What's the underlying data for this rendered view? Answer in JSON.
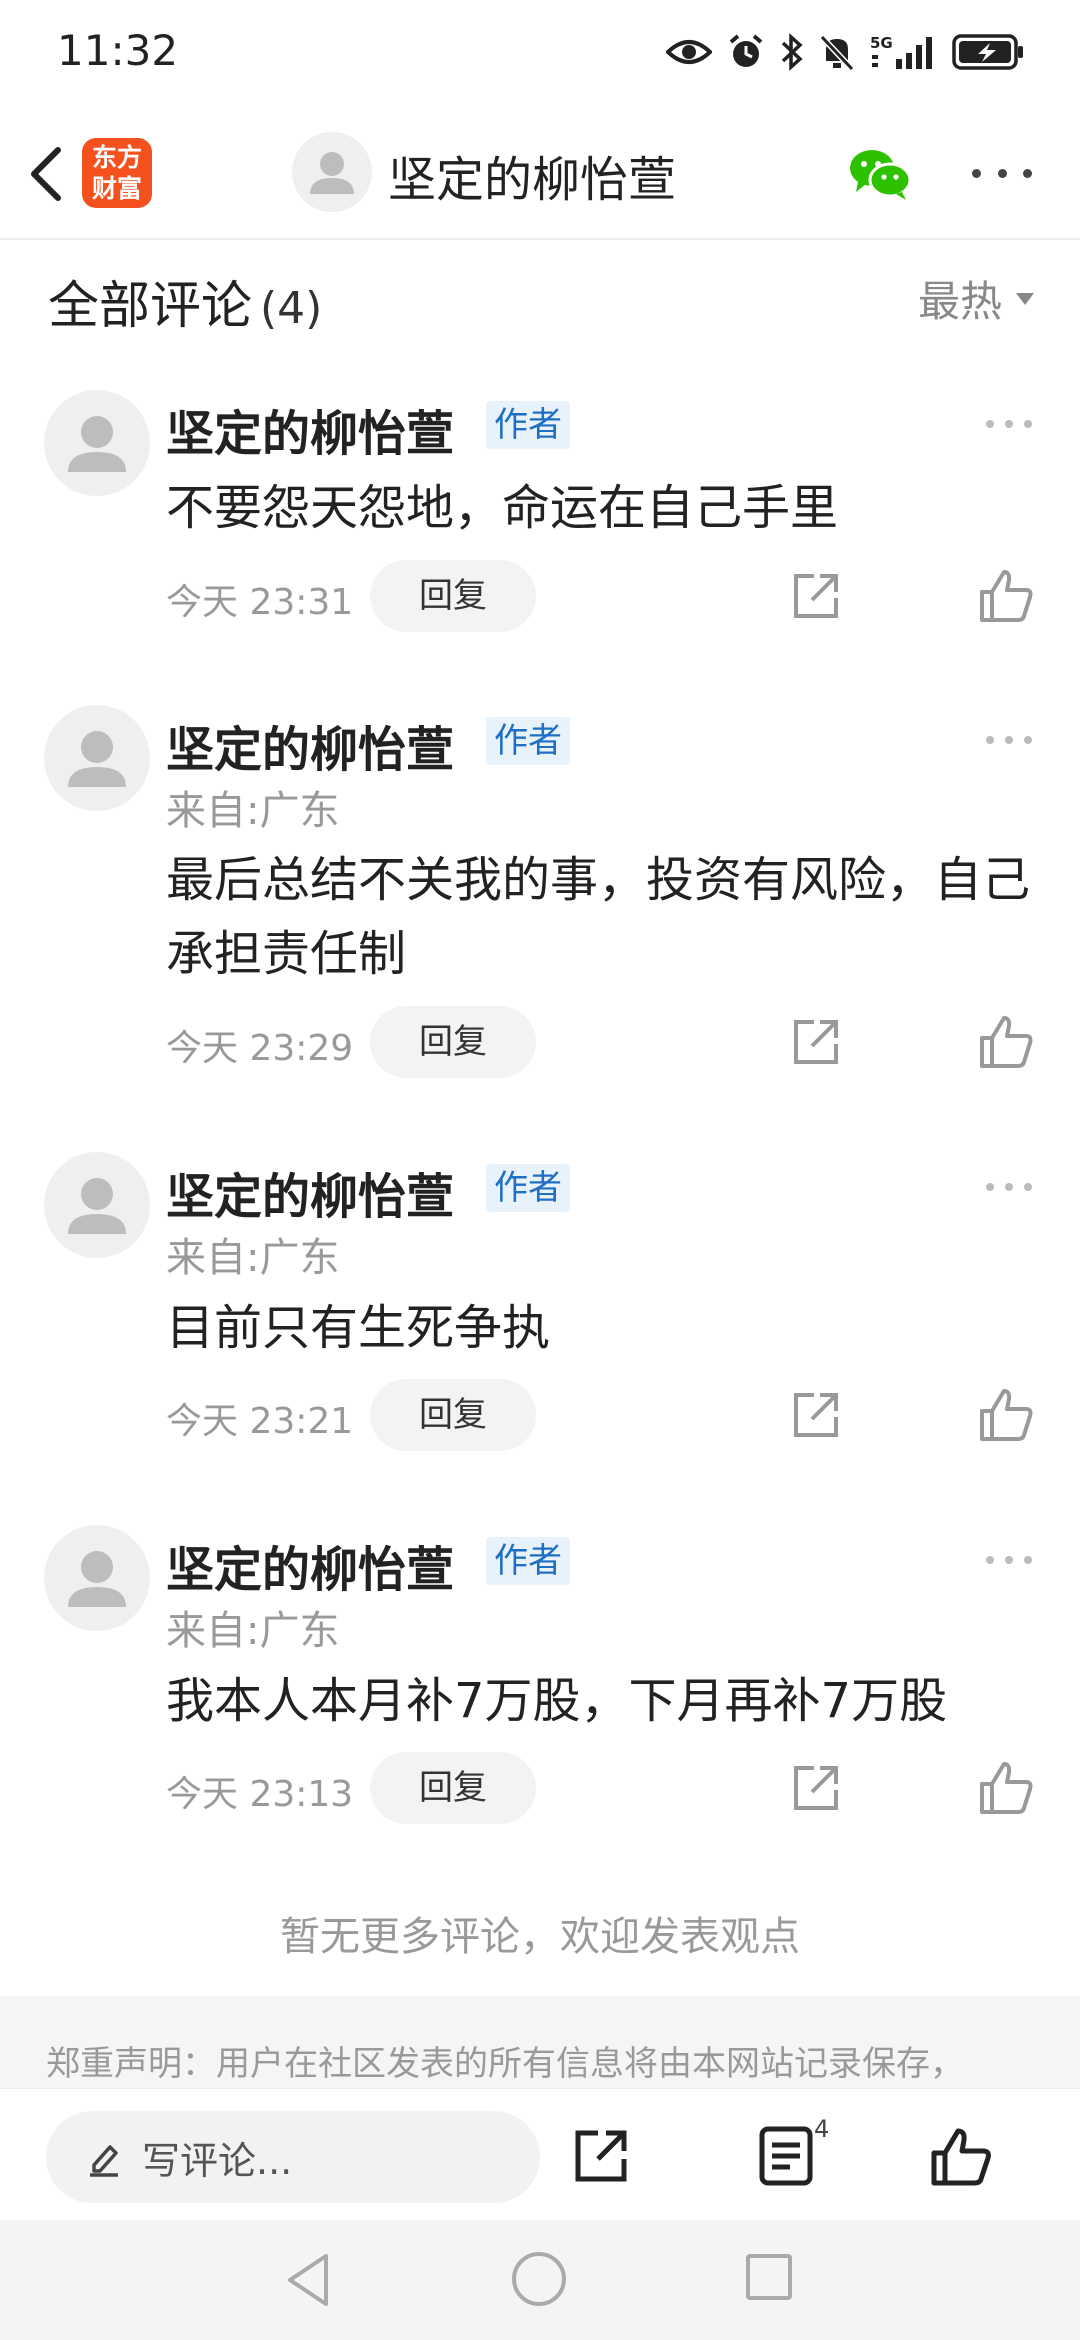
{
  "status_bar": {
    "time": "11:32",
    "icons": [
      "eye-icon",
      "alarm-icon",
      "bluetooth-icon",
      "mute-icon",
      "5g-signal-icon",
      "battery-charging-icon"
    ],
    "network_label": "5G"
  },
  "header": {
    "app_logo_line1": "东方",
    "app_logo_line2": "财富",
    "title": "坚定的柳怡萱"
  },
  "section": {
    "title": "全部评论",
    "count": "(4)",
    "sort_label": "最热"
  },
  "comments": [
    {
      "name": "坚定的柳怡萱",
      "tag": "作者",
      "location": "",
      "text": "不要怨天怨地，命运在自己手里",
      "time": "今天 23:31",
      "reply_label": "回复"
    },
    {
      "name": "坚定的柳怡萱",
      "tag": "作者",
      "location": "来自:广东",
      "text": "最后总结不关我的事，投资有风险，自己承担责任制",
      "time": "今天 23:29",
      "reply_label": "回复"
    },
    {
      "name": "坚定的柳怡萱",
      "tag": "作者",
      "location": "来自:广东",
      "text": "目前只有生死争执",
      "time": "今天 23:21",
      "reply_label": "回复"
    },
    {
      "name": "坚定的柳怡萱",
      "tag": "作者",
      "location": "来自:广东",
      "text": "我本人本月补7万股，下月再补7万股",
      "time": "今天 23:13",
      "reply_label": "回复"
    }
  ],
  "footer": {
    "no_more": "暂无更多评论，欢迎发表观点",
    "disclaimer": "郑重声明：用户在社区发表的所有信息将由本网站记录保存，"
  },
  "bottom_bar": {
    "input_placeholder": "写评论...",
    "comment_count": "4"
  },
  "colors": {
    "logo": "#f4511e",
    "author_tag_bg": "#e8f2fb",
    "author_tag_text": "#1f6fc5",
    "wechat_green": "#2dc100"
  }
}
